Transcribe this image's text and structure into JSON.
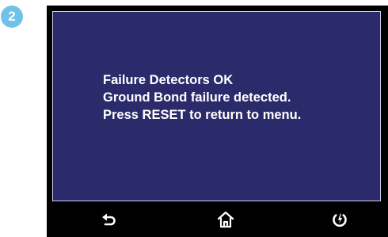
{
  "step": {
    "number": "2"
  },
  "screen": {
    "message_lines": [
      "Failure Detectors OK",
      "Ground Bond failure detected.",
      "Press RESET to return to menu."
    ]
  },
  "nav": [
    {
      "icon": "back-arrow-icon"
    },
    {
      "icon": "home-icon"
    },
    {
      "icon": "power-icon"
    }
  ],
  "colors": {
    "badge": "#6fc2e8",
    "panel_background": "#2b2a6b",
    "screen_frame": "#000000",
    "text": "#ffffff"
  }
}
